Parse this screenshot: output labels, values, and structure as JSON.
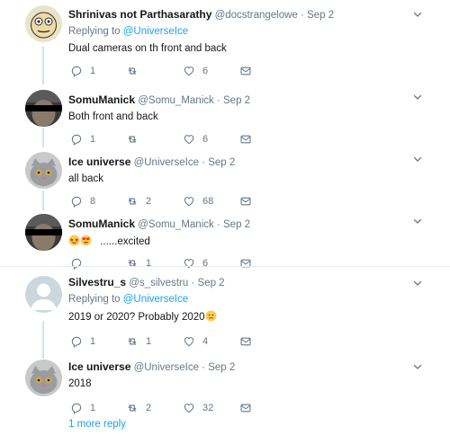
{
  "tweets": [
    {
      "name": "Shrinivas not Parthasarathy",
      "handle": "@docstrangelowe",
      "separator": "·",
      "date": "Sep 2",
      "replying_prefix": "Replying to ",
      "replying_mention": "@UniverseIce",
      "text": "Dual cameras on th front and back",
      "reply_count": "1",
      "retweet_count": "",
      "like_count": "6"
    },
    {
      "name": "SomuManick",
      "handle": "@Somu_Manick",
      "separator": "·",
      "date": "Sep 2",
      "text": "Both front and back",
      "reply_count": "1",
      "retweet_count": "",
      "like_count": "6"
    },
    {
      "name": "Ice universe",
      "handle": "@UniverseIce",
      "separator": "·",
      "date": "Sep 2",
      "text": "all back",
      "reply_count": "8",
      "retweet_count": "2",
      "like_count": "68"
    },
    {
      "name": "SomuManick",
      "handle": "@Somu_Manick",
      "separator": "·",
      "date": "Sep 2",
      "text": "......excited",
      "reply_count": "",
      "retweet_count": "1",
      "like_count": "6"
    },
    {
      "name": "Silvestru_s",
      "handle": "@s_silvestru",
      "separator": "·",
      "date": "Sep 2",
      "replying_prefix": "Replying to ",
      "replying_mention": "@UniverseIce",
      "text": "2019 or 2020?  Probably 2020",
      "reply_count": "1",
      "retweet_count": "1",
      "like_count": "4"
    },
    {
      "name": "Ice universe",
      "handle": "@UniverseIce",
      "separator": "·",
      "date": "Sep 2",
      "text": "2018",
      "reply_count": "1",
      "retweet_count": "2",
      "like_count": "32"
    }
  ],
  "more_replies": "1 more reply",
  "colors": {
    "accent": "#1da1f2",
    "muted": "#657786",
    "text": "#14171a"
  }
}
